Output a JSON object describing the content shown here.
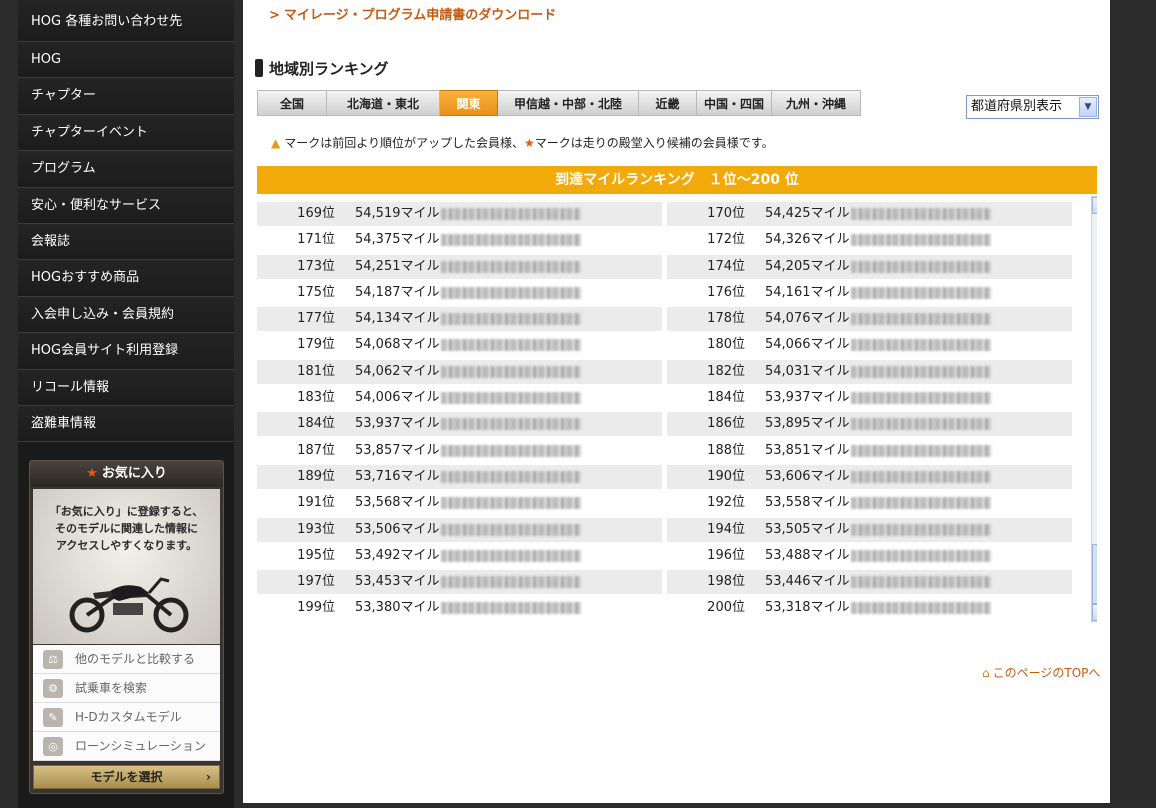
{
  "sidebar": {
    "menu": [
      "HOG 各種お問い合わせ先",
      "HOG",
      "チャプター",
      "チャプターイベント",
      "プログラム",
      "安心・便利なサービス",
      "会報誌",
      "HOGおすすめ商品",
      "入会申し込み・会員規約",
      "HOG会員サイト利用登録",
      "リコール情報",
      "盗難車情報"
    ],
    "favorites": {
      "title": "お気に入り",
      "promo_line1": "「お気に入り」に登録すると、",
      "promo_line2": "そのモデルに関連した情報に",
      "promo_line3": "アクセスしやすくなります。",
      "links": [
        "他のモデルと比較する",
        "試乗車を検索",
        "H-Dカスタムモデル",
        "ローンシミュレーション"
      ],
      "button": "モデルを選択"
    }
  },
  "main": {
    "download_link": "マイレージ・プログラム申請書のダウンロード",
    "section_title": "地域別ランキング",
    "tabs": [
      "全国",
      "北海道・東北",
      "関東",
      "甲信越・中部・北陸",
      "近畿",
      "中国・四国",
      "九州・沖縄"
    ],
    "active_tab": "関東",
    "prefecture_select": "都道府県別表示",
    "legend_part1": "マークは前回より順位がアップした会員様、",
    "legend_part2": "マークは走りの殿堂入り候補の会員様です。",
    "ranking_header": "到達マイルランキング　１位～200 位",
    "page_top": "このページのTOPへ"
  },
  "rankings": [
    {
      "left": {
        "rank": "169位",
        "miles": "54,519マイル"
      },
      "right": {
        "rank": "170位",
        "miles": "54,425マイル"
      }
    },
    {
      "left": {
        "rank": "171位",
        "miles": "54,375マイル"
      },
      "right": {
        "rank": "172位",
        "miles": "54,326マイル"
      }
    },
    {
      "left": {
        "rank": "173位",
        "miles": "54,251マイル"
      },
      "right": {
        "rank": "174位",
        "miles": "54,205マイル"
      }
    },
    {
      "left": {
        "rank": "175位",
        "miles": "54,187マイル"
      },
      "right": {
        "rank": "176位",
        "miles": "54,161マイル"
      }
    },
    {
      "left": {
        "rank": "177位",
        "miles": "54,134マイル"
      },
      "right": {
        "rank": "178位",
        "miles": "54,076マイル"
      }
    },
    {
      "left": {
        "rank": "179位",
        "miles": "54,068マイル"
      },
      "right": {
        "rank": "180位",
        "miles": "54,066マイル"
      }
    },
    {
      "left": {
        "rank": "181位",
        "miles": "54,062マイル"
      },
      "right": {
        "rank": "182位",
        "miles": "54,031マイル"
      }
    },
    {
      "left": {
        "rank": "183位",
        "miles": "54,006マイル"
      },
      "right": {
        "rank": "184位",
        "miles": "53,937マイル"
      }
    },
    {
      "left": {
        "rank": "184位",
        "miles": "53,937マイル"
      },
      "right": {
        "rank": "186位",
        "miles": "53,895マイル"
      }
    },
    {
      "left": {
        "rank": "187位",
        "miles": "53,857マイル"
      },
      "right": {
        "rank": "188位",
        "miles": "53,851マイル"
      }
    },
    {
      "left": {
        "rank": "189位",
        "miles": "53,716マイル"
      },
      "right": {
        "rank": "190位",
        "miles": "53,606マイル"
      }
    },
    {
      "left": {
        "rank": "191位",
        "miles": "53,568マイル"
      },
      "right": {
        "rank": "192位",
        "miles": "53,558マイル"
      }
    },
    {
      "left": {
        "rank": "193位",
        "miles": "53,506マイル"
      },
      "right": {
        "rank": "194位",
        "miles": "53,505マイル"
      }
    },
    {
      "left": {
        "rank": "195位",
        "miles": "53,492マイル"
      },
      "right": {
        "rank": "196位",
        "miles": "53,488マイル"
      }
    },
    {
      "left": {
        "rank": "197位",
        "miles": "53,453マイル"
      },
      "right": {
        "rank": "198位",
        "miles": "53,446マイル"
      }
    },
    {
      "left": {
        "rank": "199位",
        "miles": "53,380マイル"
      },
      "right": {
        "rank": "200位",
        "miles": "53,318マイル"
      }
    }
  ]
}
